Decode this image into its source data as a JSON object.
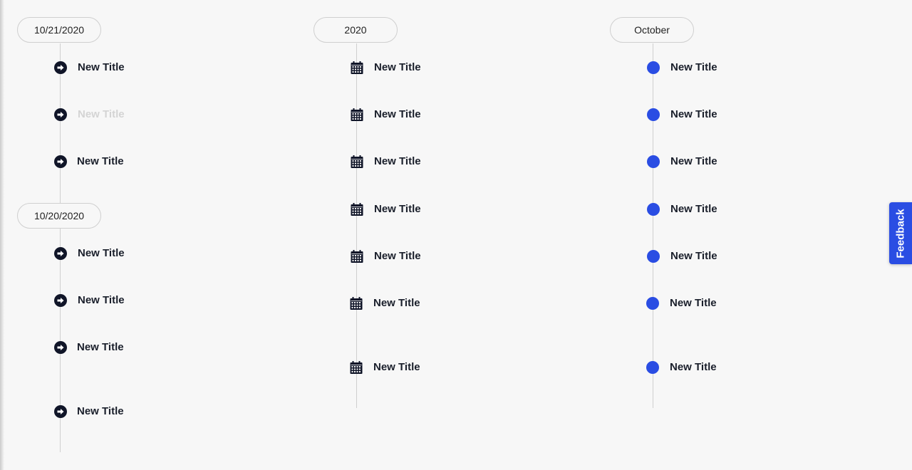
{
  "colors": {
    "accent": "#2a4de3",
    "icon_dark": "#101528",
    "line": "#cfcfcf",
    "faded_text": "#d4d4d4"
  },
  "timelines": [
    {
      "groups": [
        {
          "label": "10/21/2020",
          "items": [
            {
              "title": "New Title",
              "icon": "arrow-right-circle-icon"
            },
            {
              "title": "New Title",
              "icon": "arrow-right-circle-icon",
              "faded": true
            },
            {
              "title": "New Title",
              "icon": "arrow-right-circle-icon"
            }
          ]
        },
        {
          "label": "10/20/2020",
          "items": [
            {
              "title": "New Title",
              "icon": "arrow-right-circle-icon"
            },
            {
              "title": "New Title",
              "icon": "arrow-right-circle-icon"
            },
            {
              "title": "New Title",
              "icon": "arrow-right-circle-icon"
            },
            {
              "title": "New Title",
              "icon": "arrow-right-circle-icon"
            }
          ]
        }
      ]
    },
    {
      "groups": [
        {
          "label": "2020",
          "items": [
            {
              "title": "New Title",
              "icon": "calendar-icon"
            },
            {
              "title": "New Title",
              "icon": "calendar-icon"
            },
            {
              "title": "New Title",
              "icon": "calendar-icon"
            },
            {
              "title": "New Title",
              "icon": "calendar-icon"
            },
            {
              "title": "New Title",
              "icon": "calendar-icon"
            },
            {
              "title": "New Title",
              "icon": "calendar-icon"
            },
            {
              "title": "New Title",
              "icon": "calendar-icon"
            }
          ]
        }
      ]
    },
    {
      "groups": [
        {
          "label": "October",
          "items": [
            {
              "title": "New Title",
              "icon": "dot-icon"
            },
            {
              "title": "New Title",
              "icon": "dot-icon"
            },
            {
              "title": "New Title",
              "icon": "dot-icon"
            },
            {
              "title": "New Title",
              "icon": "dot-icon"
            },
            {
              "title": "New Title",
              "icon": "dot-icon"
            },
            {
              "title": "New Title",
              "icon": "dot-icon"
            },
            {
              "title": "New Title",
              "icon": "dot-icon"
            }
          ]
        }
      ]
    }
  ],
  "feedback_label": "Feedback"
}
